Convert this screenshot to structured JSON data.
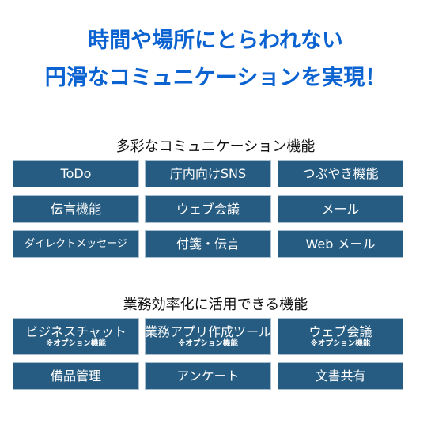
{
  "headline": {
    "line1": "時間や場所にとらわれない",
    "line2": "円滑なコミュニケーションを実現！"
  },
  "colors": {
    "headline": "#0a63d1",
    "box_fill": "#265c82",
    "box_text": "#ffffff"
  },
  "sections": [
    {
      "title": "多彩なコミュニケーション機能",
      "items": [
        {
          "label": "ToDo"
        },
        {
          "label": "庁内向けSNS"
        },
        {
          "label": "つぶやき機能"
        },
        {
          "label": "伝言機能"
        },
        {
          "label": "ウェブ会議"
        },
        {
          "label": "メール"
        },
        {
          "label": "ダイレクトメッセージ"
        },
        {
          "label": "付箋・伝言"
        },
        {
          "label": "Web メール"
        }
      ]
    },
    {
      "title": "業務効率化に活用できる機能",
      "items": [
        {
          "label": "ビジネスチャット",
          "note": "※オプション機能"
        },
        {
          "label": "業務アプリ作成ツール",
          "note": "※オプション機能"
        },
        {
          "label": "ウェブ会議",
          "note": "※オプション機能"
        },
        {
          "label": "備品管理"
        },
        {
          "label": "アンケート"
        },
        {
          "label": "文書共有"
        }
      ]
    }
  ]
}
